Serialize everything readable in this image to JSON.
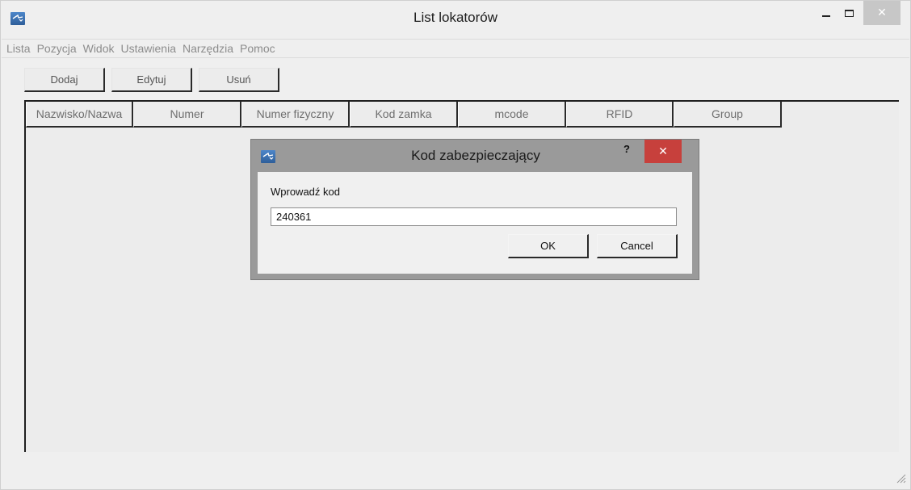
{
  "window": {
    "title": "List lokatorów",
    "close_glyph": "✕"
  },
  "menu": [
    "Lista",
    "Pozycja",
    "Widok",
    "Ustawienia",
    "Narzędzia",
    "Pomoc"
  ],
  "toolbar": {
    "add_label": "Dodaj",
    "edit_label": "Edytuj",
    "delete_label": "Usuń"
  },
  "table": {
    "columns": [
      "Nazwisko/Nazwa",
      "Numer",
      "Numer fizyczny",
      "Kod zamka",
      "mcode",
      "RFID",
      "Group"
    ],
    "rows": []
  },
  "dialog": {
    "title": "Kod zabezpieczający",
    "help_glyph": "?",
    "close_glyph": "✕",
    "prompt_label": "Wprowadź kod",
    "input_value": "240361",
    "ok_label": "OK",
    "cancel_label": "Cancel"
  },
  "colors": {
    "dialog_close": "#c7403c",
    "window_bg": "#efefef",
    "menu_text": "#8c8c8c"
  },
  "icons": {
    "app": "app-logo-icon",
    "minimize": "minimize-icon",
    "maximize": "maximize-icon",
    "close": "close-icon",
    "help": "help-icon",
    "grip": "resize-grip-icon"
  }
}
